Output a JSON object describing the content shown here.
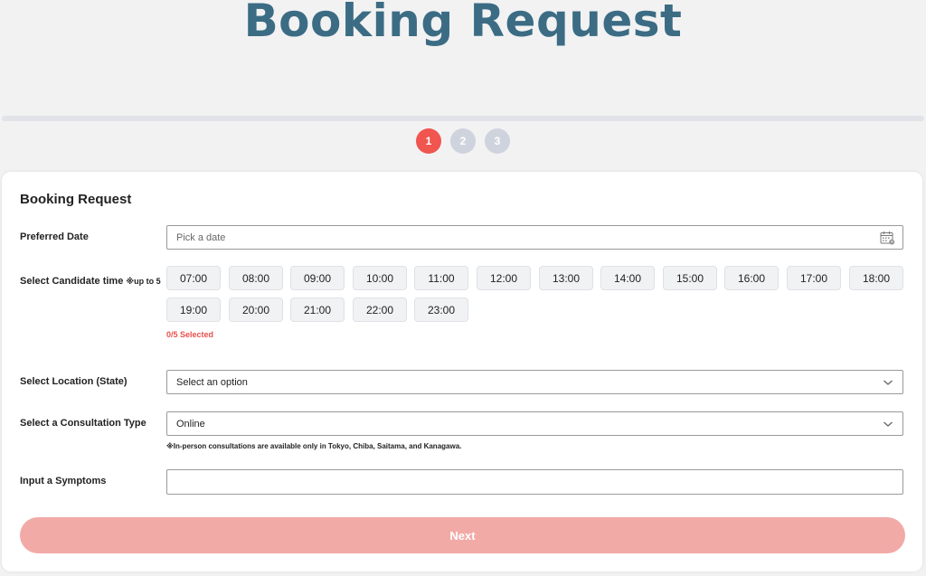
{
  "page_title": "Booking Request",
  "steps": [
    "1",
    "2",
    "3"
  ],
  "active_step": 1,
  "form": {
    "title": "Booking Request",
    "preferred_date": {
      "label": "Preferred Date",
      "placeholder": "Pick a date",
      "icon": "calendar-icon"
    },
    "candidate_time": {
      "label": "Select Candidate time",
      "note": "※up to 5",
      "options": [
        "07:00",
        "08:00",
        "09:00",
        "10:00",
        "11:00",
        "12:00",
        "13:00",
        "14:00",
        "15:00",
        "16:00",
        "17:00",
        "18:00",
        "19:00",
        "20:00",
        "21:00",
        "22:00",
        "23:00"
      ],
      "selected_text": "0/5 Selected",
      "selected_count": 0,
      "max": 5
    },
    "location": {
      "label": "Select Location (State)",
      "value": "Select an option"
    },
    "consultation_type": {
      "label": "Select a Consultation Type",
      "value": "Online",
      "hint": "※In-person consultations are available only in Tokyo, Chiba, Saitama, and Kanagawa."
    },
    "symptoms": {
      "label": "Input a Symptoms",
      "value": ""
    },
    "next_label": "Next"
  },
  "colors": {
    "title": "#3b6c84",
    "accent": "#f0554f",
    "next_button": "#f2aaa7",
    "step_inactive": "#cfd3dd"
  }
}
